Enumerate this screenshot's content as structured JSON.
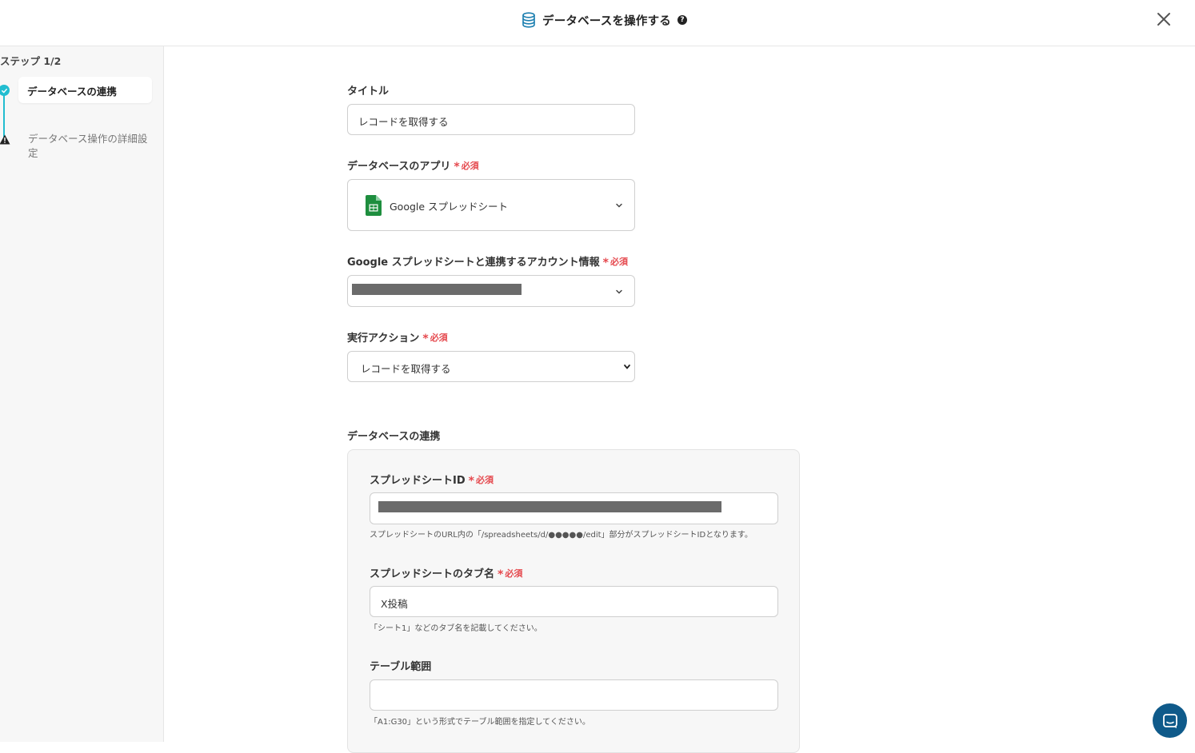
{
  "header": {
    "title": "データベースを操作する",
    "help_symbol": "?",
    "title_icon": "database-icon",
    "close_icon": "close-icon"
  },
  "sidebar": {
    "step_count": "ステップ 1/2",
    "steps": [
      {
        "label": "データベースの連携",
        "status": "complete",
        "active": true
      },
      {
        "label": "データベース操作の詳細設定",
        "status": "warning",
        "active": false
      }
    ]
  },
  "form": {
    "title": {
      "label": "タイトル",
      "value": "レコードを取得する"
    },
    "app": {
      "label": "データベースのアプリ",
      "required": "必須",
      "value": "Google スプレッドシート",
      "icon": "google-sheets-icon"
    },
    "account": {
      "label": "Google スプレッドシートと連携するアカウント情報",
      "required": "必須"
    },
    "action": {
      "label": "実行アクション",
      "required": "必須",
      "value": "レコードを取得する"
    }
  },
  "section": {
    "title": "データベースの連携",
    "spreadsheet_id": {
      "label": "スプレッドシートID",
      "required": "必須",
      "hint": "スプレッドシートのURL内の「/spreadsheets/d/●●●●●/edit」部分がスプレッドシートIDとなります。"
    },
    "tab_name": {
      "label": "スプレッドシートのタブ名",
      "required": "必須",
      "value": "X投稿",
      "hint": "「シート1」などのタブ名を記載してください。"
    },
    "table_range": {
      "label": "テーブル範囲",
      "value": "",
      "hint": "「A1:G30」という形式でテーブル範囲を指定してください。"
    }
  },
  "colors": {
    "accent": "#22bdd0",
    "required": "#e5484d",
    "chat": "#0f5a8a",
    "sheets_green": "#1e8e3e"
  }
}
